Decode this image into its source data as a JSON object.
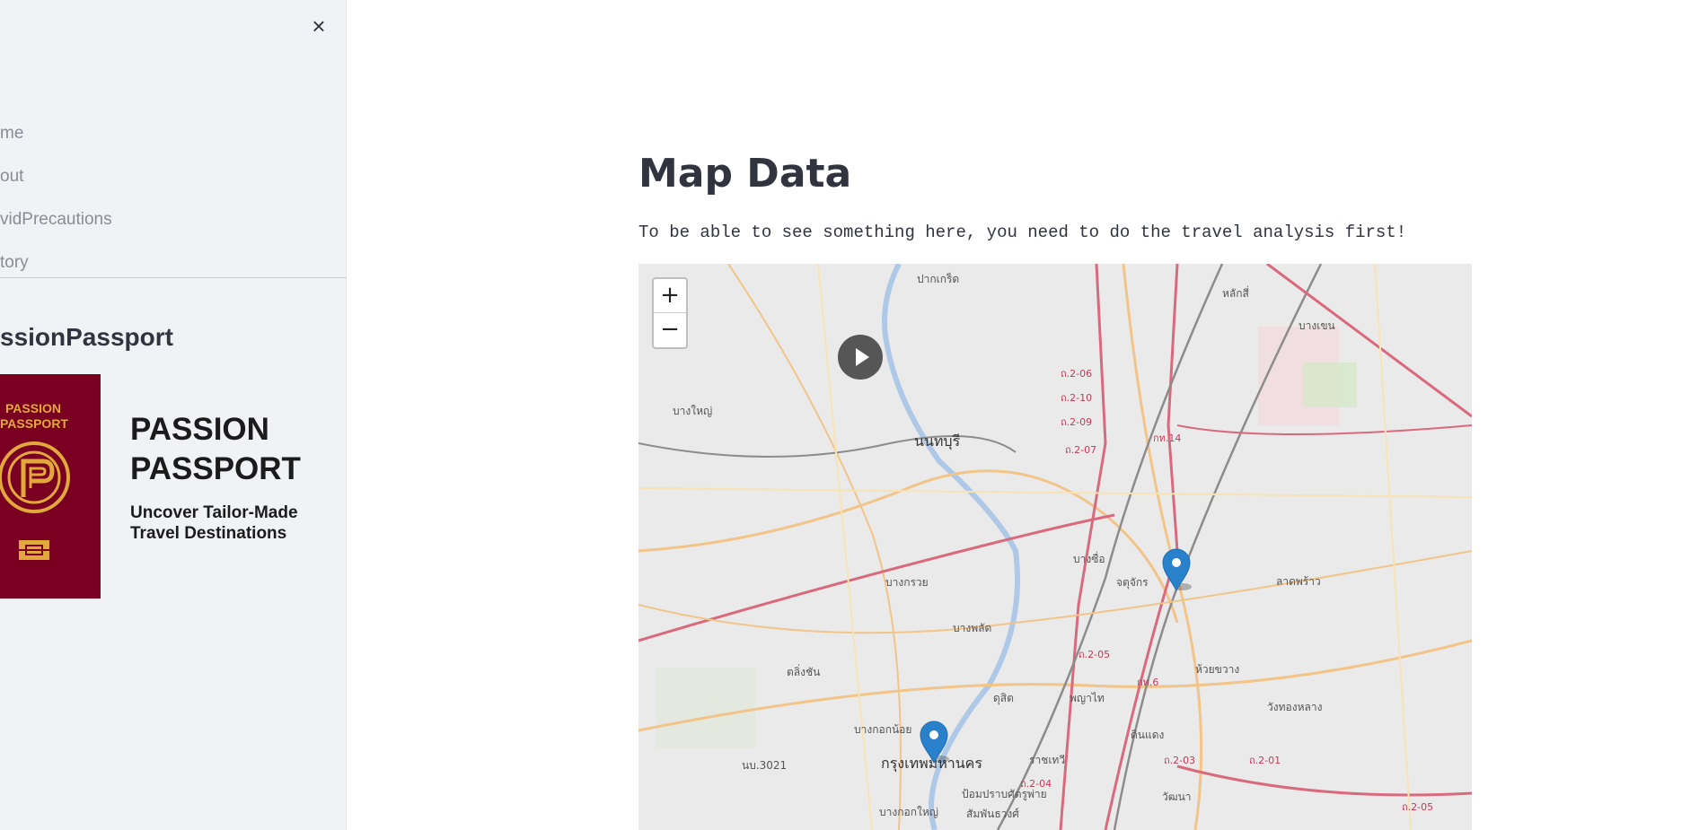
{
  "sidebar": {
    "close_icon": "×",
    "nav_items": [
      {
        "label": "me"
      },
      {
        "label": "out"
      },
      {
        "label": "vidPrecautions"
      },
      {
        "label": "tory"
      }
    ],
    "brand_title": "ssionPassport",
    "logo": {
      "passport_text": "PASSION PASSPORT",
      "title": "PASSION PASSPORT",
      "subtitle": "Uncover Tailor-Made Travel Destinations",
      "passport_color": "#7a0022",
      "gold_color": "#e3a83c"
    }
  },
  "main": {
    "title": "Map Data",
    "notice": "To be able to see something here, you need to do the travel analysis first!",
    "map": {
      "zoom_in": "+",
      "zoom_out": "−",
      "marker_color": "#2a81cb",
      "labels": [
        "นนทบุรี",
        "บางใหญ่",
        "บางกรวย",
        "กรุงเทพมหานคร",
        "ลาดพร้าว",
        "ห้วยขวาง",
        "วังทองหลาง",
        "จตุจักร",
        "บางซื่อ",
        "ดุสิต",
        "พญาไท",
        "ดินแดง",
        "ราชเทวี",
        "บางพลัด",
        "ตลิ่งชัน",
        "หลักสี่",
        "บางเขน",
        "ปากเกร็ด",
        "บางกอกน้อย",
        "บางกอกใหญ่",
        "ป้อมปราบศัตรูพ่าย",
        "สัมพันธวงศ์",
        "วัฒนา",
        "นบ.3021"
      ],
      "road_labels": [
        "ถ.2-06",
        "ถ.2-10",
        "ถ.2-09",
        "ถ.2-07",
        "กท.14",
        "กท.6",
        "ถ.2-05",
        "ถ.2-04",
        "ถ.2-03",
        "ถ.2-01",
        "ถ.2-05"
      ]
    }
  }
}
